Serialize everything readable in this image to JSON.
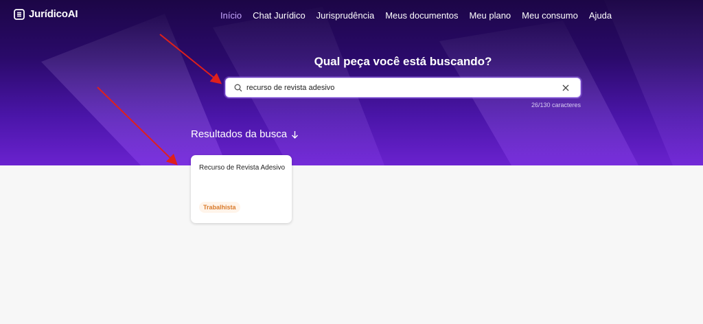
{
  "brand": {
    "name": "JurídicoAI"
  },
  "nav": {
    "items": [
      {
        "label": "Início",
        "active": true
      },
      {
        "label": "Chat Jurídico",
        "active": false
      },
      {
        "label": "Jurisprudência",
        "active": false
      },
      {
        "label": "Meus documentos",
        "active": false
      },
      {
        "label": "Meu plano",
        "active": false
      },
      {
        "label": "Meu consumo",
        "active": false
      },
      {
        "label": "Ajuda",
        "active": false
      }
    ]
  },
  "hero": {
    "headline": "Qual peça você está buscando?"
  },
  "search": {
    "value": "recurso de revista adesivo",
    "counter": "26/130 caracteres"
  },
  "results": {
    "title": "Resultados da busca",
    "cards": [
      {
        "title": "Recurso de Revista Adesivo",
        "tag": "Trabalhista"
      }
    ]
  },
  "colors": {
    "hero_top": "#1c0646",
    "hero_bottom": "#6a22cf",
    "nav_active": "#c7a8ff",
    "tag_text": "#d97a2b",
    "annotation_arrow": "#e0201b"
  }
}
